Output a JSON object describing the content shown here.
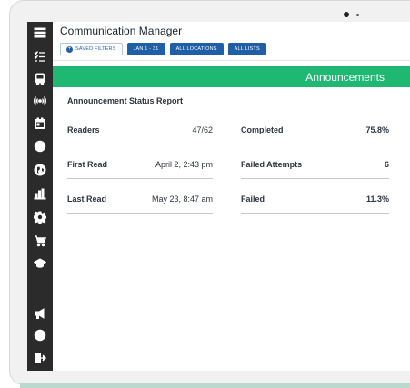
{
  "app": {
    "title": "Communication Manager"
  },
  "filters": {
    "saved_filters": "SAVED FILTERS",
    "date_range": "JAN 1 - 31",
    "locations": "ALL LOCATIONS",
    "lists": "ALL LISTS"
  },
  "sidebar": {
    "icons": [
      "menu-icon",
      "checklist-icon",
      "bus-icon",
      "broadcast-icon",
      "calendar-icon",
      "clock-icon",
      "globe-icon",
      "bar-chart-icon",
      "gear-icon",
      "cart-icon",
      "graduation-cap-icon",
      "megaphone-icon",
      "lifebuoy-icon",
      "logout-icon"
    ]
  },
  "banner": {
    "title": "Announcements"
  },
  "report": {
    "title": "Announcement Status Report",
    "left": [
      {
        "label": "Readers",
        "value": "47/62"
      },
      {
        "label": "First Read",
        "value": "April 2, 2:43 pm"
      },
      {
        "label": "Last Read",
        "value": "May 23, 8:47 am"
      }
    ],
    "right": [
      {
        "label": "Completed",
        "value": "75.8%"
      },
      {
        "label": "Failed Attempts",
        "value": "6"
      },
      {
        "label": "Failed",
        "value": "11.3%"
      }
    ]
  },
  "colors": {
    "sidebar": "#2b2b2b",
    "banner": "#1fb873",
    "button": "#1f5fa8"
  }
}
